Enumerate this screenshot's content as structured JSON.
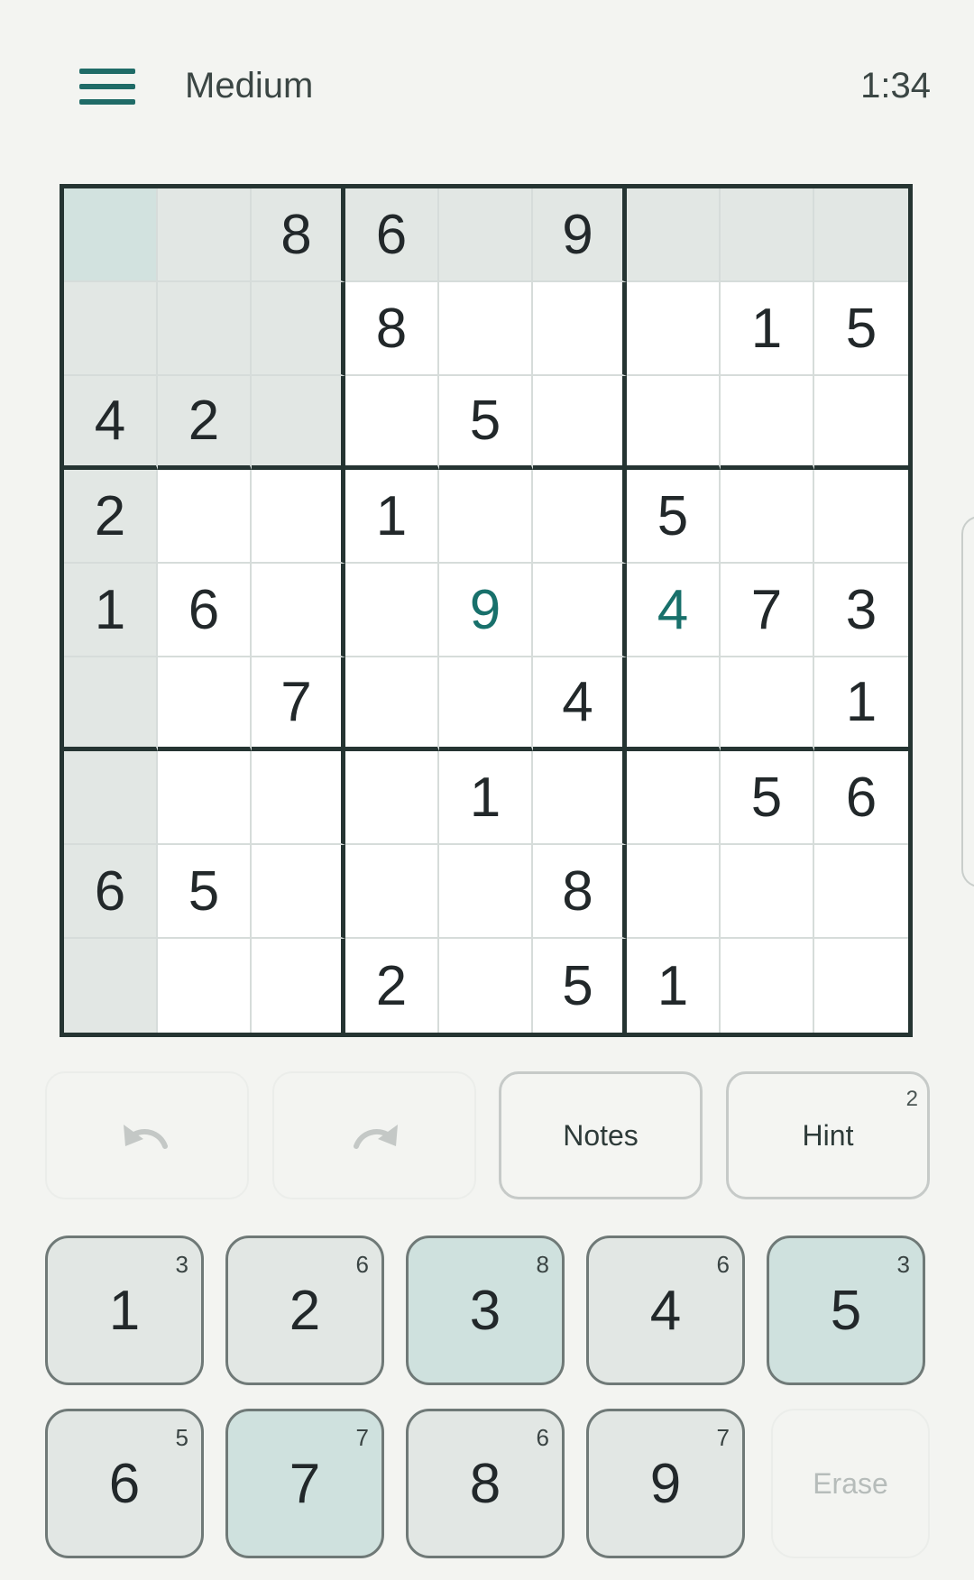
{
  "header": {
    "difficulty": "Medium",
    "timer": "1:34"
  },
  "board": {
    "rows": [
      [
        "",
        "",
        "8",
        "6",
        "",
        "9",
        "",
        "",
        ""
      ],
      [
        "",
        "",
        "",
        "8",
        "",
        "",
        "",
        "1",
        "5"
      ],
      [
        "4",
        "2",
        "",
        "",
        "5",
        "",
        "",
        "",
        ""
      ],
      [
        "2",
        "",
        "",
        "1",
        "",
        "",
        "5",
        "",
        ""
      ],
      [
        "1",
        "6",
        "",
        "",
        "9",
        "",
        "4",
        "7",
        "3"
      ],
      [
        "",
        "",
        "7",
        "",
        "",
        "4",
        "",
        "",
        "1"
      ],
      [
        "",
        "",
        "",
        "",
        "1",
        "",
        "",
        "5",
        "6"
      ],
      [
        "6",
        "5",
        "",
        "",
        "",
        "8",
        "",
        "",
        ""
      ],
      [
        "",
        "",
        "",
        "2",
        "",
        "5",
        "1",
        "",
        ""
      ]
    ],
    "user_entered": [
      [
        4,
        4
      ],
      [
        4,
        6
      ]
    ],
    "selected_cell": [
      0,
      0
    ]
  },
  "actions": {
    "undo_icon": "undo-icon",
    "redo_icon": "redo-icon",
    "notes_label": "Notes",
    "hint_label": "Hint",
    "hint_count": "2"
  },
  "numpad": {
    "keys": [
      {
        "digit": "1",
        "count": "3"
      },
      {
        "digit": "2",
        "count": "6"
      },
      {
        "digit": "3",
        "count": "8"
      },
      {
        "digit": "4",
        "count": "6"
      },
      {
        "digit": "5",
        "count": "3"
      },
      {
        "digit": "6",
        "count": "5"
      },
      {
        "digit": "7",
        "count": "7"
      },
      {
        "digit": "8",
        "count": "6"
      },
      {
        "digit": "9",
        "count": "7"
      }
    ],
    "highlighted": [
      "3",
      "5",
      "7"
    ],
    "erase_label": "Erase"
  },
  "colors": {
    "accent": "#1f6b67",
    "highlight": "#e2e7e4",
    "selected": "#d2e2df",
    "background": "#f3f4f1"
  }
}
